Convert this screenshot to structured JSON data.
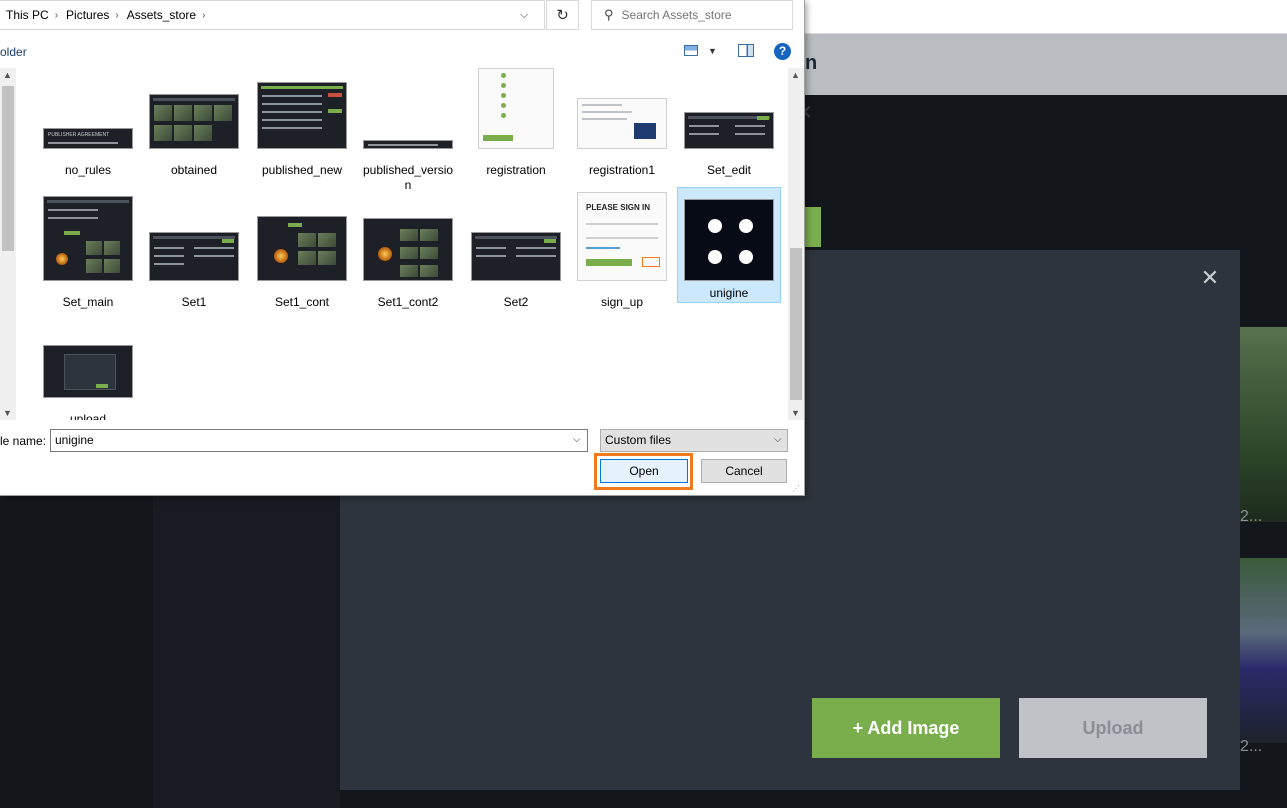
{
  "background": {
    "fragment_text": "n",
    "right_text_1": "2...",
    "right_text_2": "2..."
  },
  "modal": {
    "close_glyph": "✕",
    "add_image_label": "+ Add Image",
    "upload_label": "Upload"
  },
  "dialog": {
    "breadcrumb": [
      "This PC",
      "Pictures",
      "Assets_store"
    ],
    "search_placeholder": "Search Assets_store",
    "new_folder_label": "older",
    "help_glyph": "?",
    "files": [
      {
        "name": "no_rules"
      },
      {
        "name": "obtained"
      },
      {
        "name": "published_new"
      },
      {
        "name": "published_version"
      },
      {
        "name": "registration"
      },
      {
        "name": "registration1"
      },
      {
        "name": "Set_edit"
      },
      {
        "name": "Set_main"
      },
      {
        "name": "Set1"
      },
      {
        "name": "Set1_cont"
      },
      {
        "name": "Set1_cont2"
      },
      {
        "name": "Set2"
      },
      {
        "name": "sign_up"
      },
      {
        "name": "unigine"
      },
      {
        "name": "upload"
      }
    ],
    "selected_file": "unigine",
    "thumb_text": {
      "no_rules": "PUBLISHER AGREEMENT",
      "sign_up": "PLEASE SIGN IN"
    },
    "file_name_label": "le name:",
    "file_name_value": "unigine",
    "file_type_value": "Custom files",
    "open_label": "Open",
    "cancel_label": "Cancel"
  },
  "colors": {
    "highlight_orange": "#f07b1e",
    "add_green": "#7aae4c",
    "selected_blue": "#cce8ff"
  }
}
